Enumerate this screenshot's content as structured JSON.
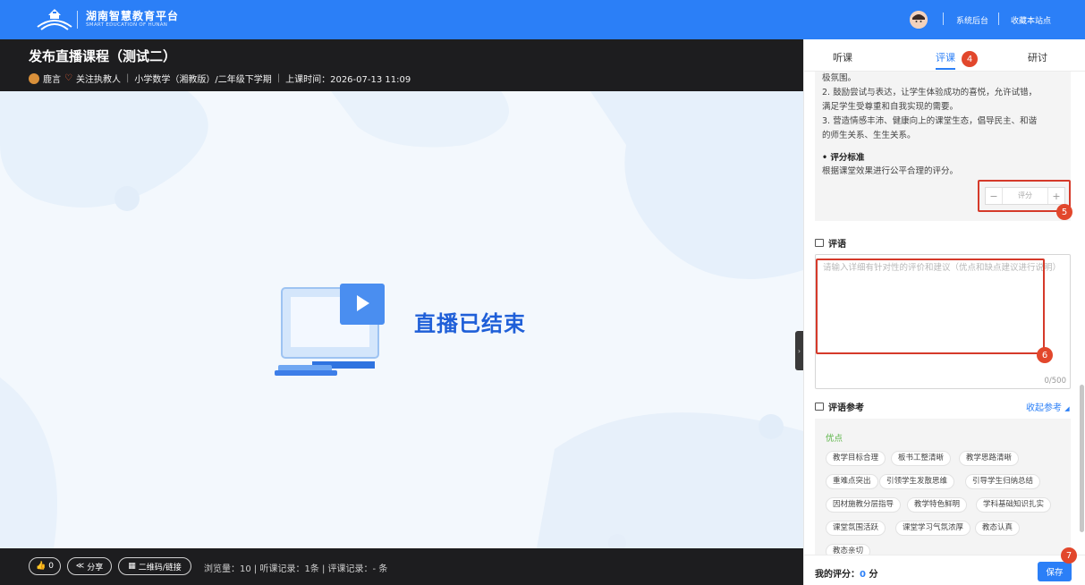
{
  "header": {
    "logo_title": "湖南智慧教育平台",
    "logo_subtitle": "SMART EDUCATION OF HUNAN",
    "link_admin": "系统后台",
    "link_bookmark": "收藏本站点"
  },
  "course": {
    "title": "发布直播课程（测试二）",
    "teacher": "鹿言",
    "follow_label": "关注执教人",
    "subject": "小学数学（湘教版）/二年级下学期",
    "time_label": "上课时间：2026-07-13 11:09"
  },
  "video": {
    "status_text": "直播已结束"
  },
  "footer": {
    "like_count": "0",
    "share_label": "分享",
    "qr_label": "二维码/链接",
    "stats": "浏览量：10 | 听课记录：1条 | 评课记录：- 条"
  },
  "tabs": [
    {
      "label": "听课"
    },
    {
      "label": "评课"
    },
    {
      "label": "研讨"
    }
  ],
  "criteria": {
    "line1": "极氛围。",
    "line2": "2. 鼓励尝试与表达，让学生体验成功的喜悦，允许试错，",
    "line3": "满足学生受尊重和自我实现的需要。",
    "line4": "3. 营造情感丰沛、健康向上的课堂生态，倡导民主、和谐",
    "line5": "的师生关系、生生关系。",
    "standard_title": "• 评分标准",
    "standard_text": "根据课堂效果进行公平合理的评分。",
    "score_placeholder": "评分",
    "minus": "−",
    "plus": "+"
  },
  "comment": {
    "title": "评语",
    "placeholder": "请输入详细有针对性的评价和建议（优点和缺点建议进行说明）",
    "counter": "0/500"
  },
  "reference": {
    "title": "评语参考",
    "collapse_label": "收起参考",
    "advantages_title": "优点",
    "chips": [
      "教学目标合理",
      "板书工整清晰",
      "教学思路清晰",
      "重难点突出",
      "引领学生发散思维",
      "引导学生归纳总结",
      "因材施教分层指导",
      "教学特色鲜明",
      "学科基础知识扎实",
      "课堂氛围活跃",
      "课堂学习气氛浓厚",
      "教态认真",
      "教态亲切"
    ]
  },
  "score": {
    "label": "我的评分：",
    "value": "0",
    "unit": "分",
    "save_label": "保存"
  },
  "annotations": {
    "b4": "4",
    "b5": "5",
    "b6": "6",
    "b7": "7"
  },
  "colors": {
    "brand_blue": "#2b7ff7",
    "highlight_red": "#d53a2a",
    "advantage_green": "#5bb446"
  }
}
